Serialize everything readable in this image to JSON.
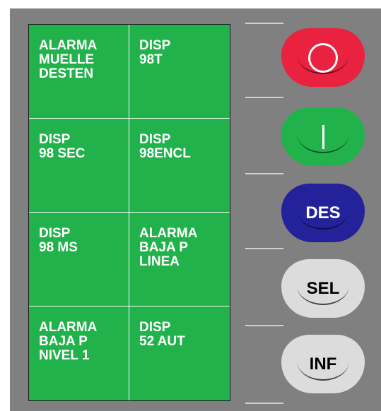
{
  "annunciator": {
    "cells": [
      {
        "lines": [
          "ALARMA",
          "MUELLE",
          "DESTEN"
        ]
      },
      {
        "lines": [
          "DISP",
          "98T",
          ""
        ]
      },
      {
        "lines": [
          "DISP",
          "98 SEC",
          ""
        ]
      },
      {
        "lines": [
          "DISP",
          "98ENCL",
          ""
        ]
      },
      {
        "lines": [
          "DISP",
          "98 MS",
          ""
        ]
      },
      {
        "lines": [
          "ALARMA",
          "BAJA P",
          "LINEA"
        ]
      },
      {
        "lines": [
          "ALARMA",
          "BAJA P",
          "NIVEL 1"
        ]
      },
      {
        "lines": [
          "DISP",
          "52 AUT",
          ""
        ]
      }
    ]
  },
  "buttons": {
    "off": {
      "icon": "power-off-circle-icon",
      "color": "#e8223f"
    },
    "on": {
      "icon": "power-on-bar-icon",
      "color": "#22b24c"
    },
    "des": {
      "label": "DES",
      "color": "#23229a"
    },
    "sel": {
      "label": "SEL",
      "color": "#dcdcdc"
    },
    "inf": {
      "label": "INF",
      "color": "#dcdcdc"
    }
  },
  "colors": {
    "panel": "#808080",
    "annunciator_bg": "#22b24c",
    "cell_text": "#ffffff"
  }
}
